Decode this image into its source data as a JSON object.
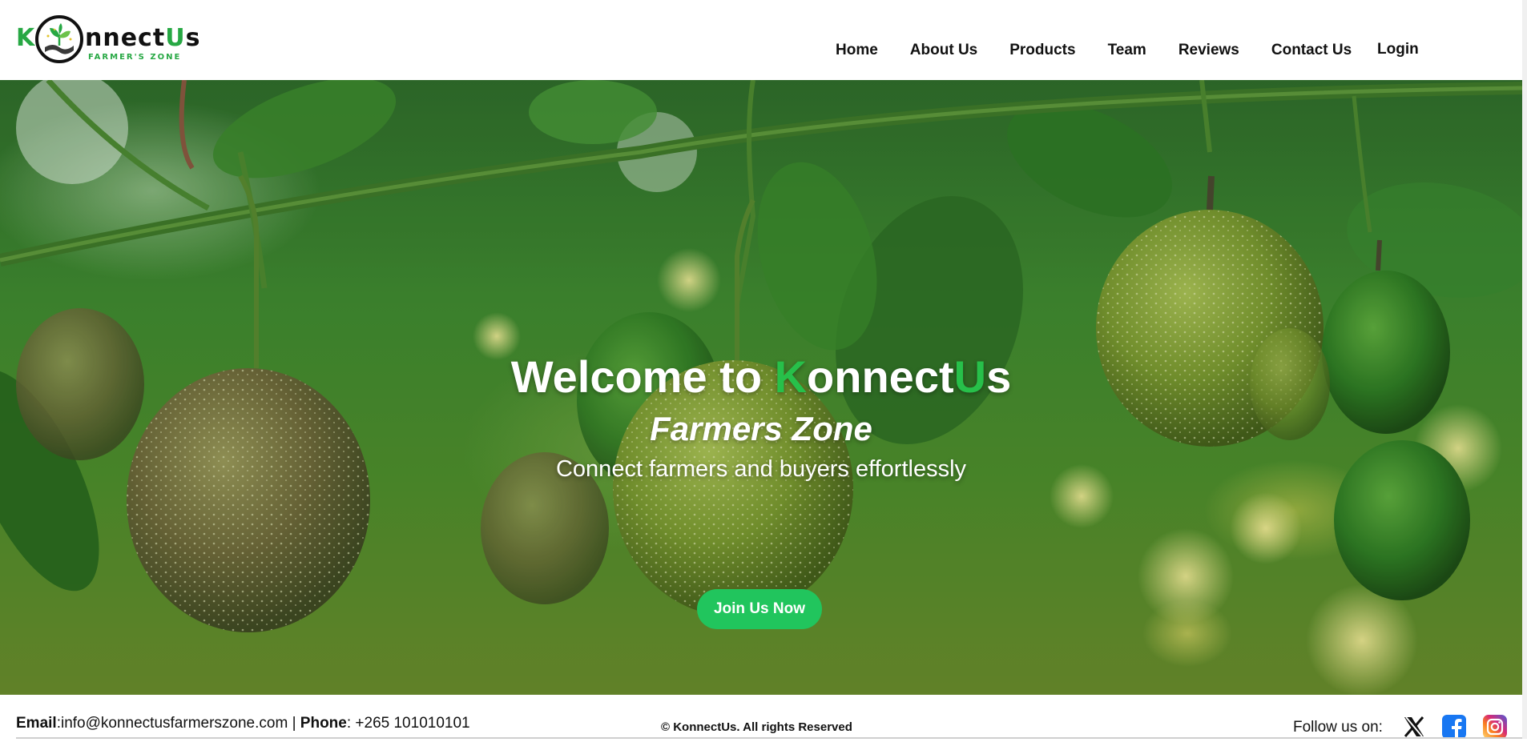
{
  "header": {
    "logo": {
      "letter_k": "K",
      "rest": "nnect",
      "u": "U",
      "s": "s",
      "subtitle": "FARMER'S ZONE"
    },
    "nav": [
      {
        "label": "Home"
      },
      {
        "label": "About Us"
      },
      {
        "label": "Products"
      },
      {
        "label": "Team"
      },
      {
        "label": "Reviews"
      },
      {
        "label": "Contact Us"
      }
    ],
    "login_label": "Login"
  },
  "hero": {
    "title_prefix": "Welcome to ",
    "title_k": "K",
    "title_mid": "onnect",
    "title_u": "U",
    "title_end": "s",
    "subtitle": "Farmers Zone",
    "tagline": "Connect farmers and buyers effortlessly",
    "cta_label": "Join Us Now",
    "accent_color": "#21c55d"
  },
  "footer": {
    "email_label": "Email",
    "email_value": ":info@konnectusfarmerszone.com",
    "separator": " | ",
    "phone_label": "Phone",
    "phone_value": ": +265 101010101",
    "copyright": "© KonnectUs. All rights Reserved",
    "follow_label": "Follow us on:",
    "social": [
      {
        "icon": "x-icon"
      },
      {
        "icon": "facebook-icon"
      },
      {
        "icon": "instagram-icon"
      }
    ]
  }
}
